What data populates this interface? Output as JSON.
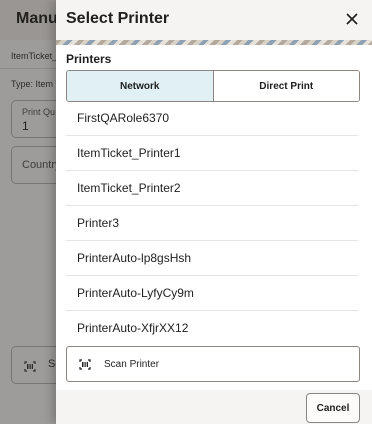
{
  "background": {
    "title": "Manu",
    "item_line": "ItemTicket_",
    "type_line": "Type: Item T",
    "print_qty_label": "Print Qu",
    "print_qty_value": "1",
    "country_label": "Country",
    "scan_label": "Sc"
  },
  "drawer": {
    "title": "Select Printer",
    "section_label": "Printers",
    "tabs": [
      {
        "label": "Network",
        "active": true
      },
      {
        "label": "Direct Print",
        "active": false
      }
    ],
    "printers": [
      "FirstQARole6370",
      "ItemTicket_Printer1",
      "ItemTicket_Printer2",
      "Printer3",
      "PrinterAuto-lp8gsHsh",
      "PrinterAuto-LyfyCy9m",
      "PrinterAuto-XfjrXX12"
    ],
    "scan_button": {
      "label": "Scan Printer",
      "icon": "barcode-scan-icon"
    },
    "cancel_label": "Cancel",
    "close_icon": "close-icon"
  },
  "colors": {
    "active_tab": "#e0f0f5",
    "header_bg": "#f6f4f2"
  }
}
